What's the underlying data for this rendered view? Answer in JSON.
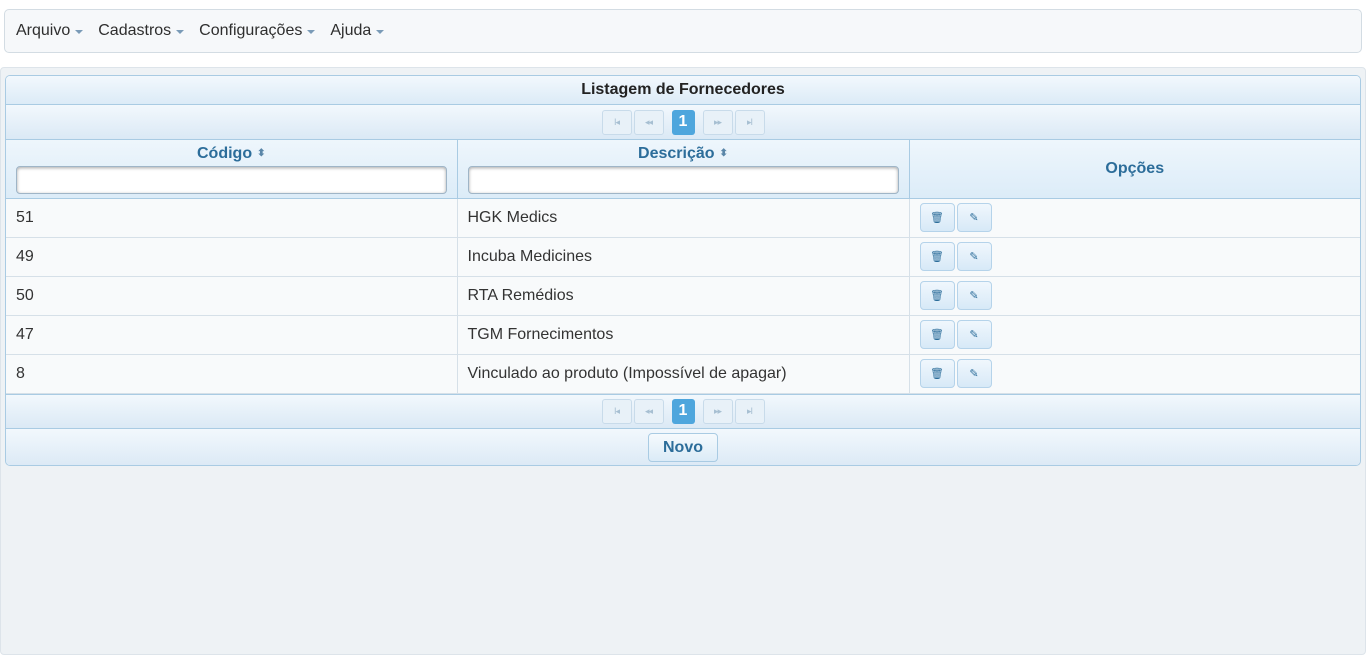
{
  "menu": [
    {
      "label": "Arquivo"
    },
    {
      "label": "Cadastros"
    },
    {
      "label": "Configurações"
    },
    {
      "label": "Ajuda"
    }
  ],
  "panel": {
    "title": "Listagem de Fornecedores"
  },
  "paginator": {
    "current_page": "1",
    "icons": [
      "first-page-icon",
      "previous-page-icon",
      "next-page-icon",
      "last-page-icon"
    ]
  },
  "table": {
    "columns": [
      {
        "label": "Código",
        "sortable": true,
        "filter_value": ""
      },
      {
        "label": "Descrição",
        "sortable": true,
        "filter_value": ""
      },
      {
        "label": "Opções",
        "sortable": false
      }
    ],
    "rows": [
      {
        "codigo": "51",
        "descricao": "HGK Medics"
      },
      {
        "codigo": "49",
        "descricao": "Incuba Medicines"
      },
      {
        "codigo": "50",
        "descricao": "RTA Remédios"
      },
      {
        "codigo": "47",
        "descricao": "TGM Fornecimentos"
      },
      {
        "codigo": "8",
        "descricao": "Vinculado ao produto (Impossível de apagar)"
      }
    ],
    "row_action_icons": [
      "trash-icon",
      "pencil-icon"
    ]
  },
  "footer": {
    "new_button": "Novo"
  },
  "colors": {
    "accent": "#4ea6dd",
    "header_text": "#2c6d9a",
    "border": "#a9cbe3"
  }
}
